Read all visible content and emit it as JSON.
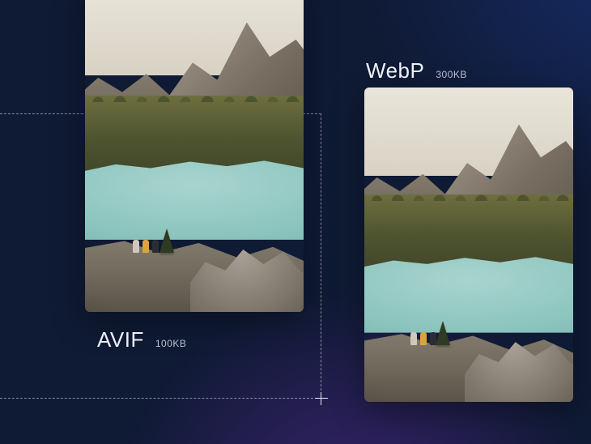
{
  "left": {
    "format": "AVIF",
    "size": "100KB"
  },
  "right": {
    "format": "WebP",
    "size": "300KB"
  }
}
